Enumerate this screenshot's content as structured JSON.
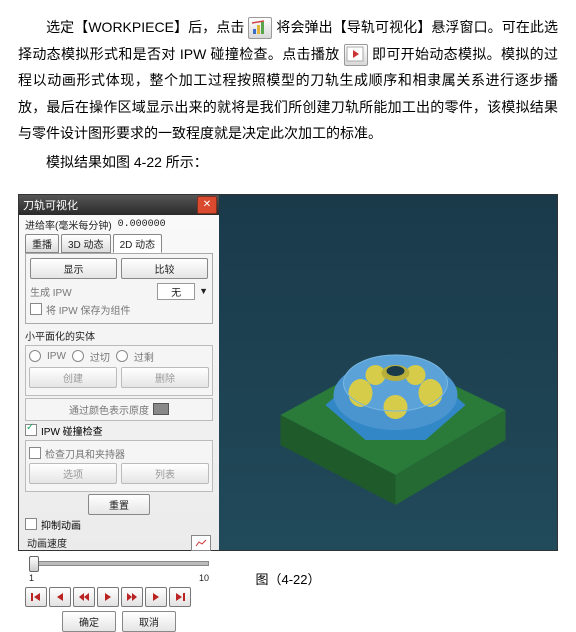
{
  "doc": {
    "p1a": "选定【WORKPIECE】后，点击",
    "p1b": "将会弹出【导轨可视化】悬浮窗口。可在此选择动态模拟形式和是否对 IPW 碰撞检查。点击播放",
    "p1c": "即可开始动态模拟。模拟的过程以动画形式体现，整个加工过程按照模型的刀轨生成顺序和相隶属关系进行逐步播放，最后在操作区域显示出来的就将是我们所创建刀轨所能加工出的零件，该模拟结果与零件设计图形要求的一致程度就是决定此次加工的标准。",
    "p2": "模拟结果如图 4-22 所示："
  },
  "panel": {
    "title": "刀轨可视化",
    "feed_label": "进给率(毫米每分钟)",
    "feed_value": "0.000000",
    "tabs": {
      "t1": "重播",
      "t2": "3D 动态",
      "t3": "2D 动态"
    },
    "btn_show": "显示",
    "btn_compare": "比较",
    "gen_label": "生成 IPW",
    "gen_opt": "无",
    "save_label": "将 IPW 保存为组件",
    "facet_title": "小平面化的实体",
    "r1": "IPW",
    "r2": "过切",
    "r3": "过剩",
    "b_create": "创建",
    "b_delete": "删除",
    "color_label": "通过颜色表示原度",
    "ipw_check": "IPW 碰撞检查",
    "tool_check": "检查刀具和夹持器",
    "b_option": "选项",
    "b_list": "列表",
    "b_reset": "重置",
    "suppress": "抑制动画",
    "anim_label": "动画速度",
    "slow": "1",
    "fast": "10",
    "ok": "确定",
    "cancel": "取消"
  },
  "caption": "图（4-22）"
}
